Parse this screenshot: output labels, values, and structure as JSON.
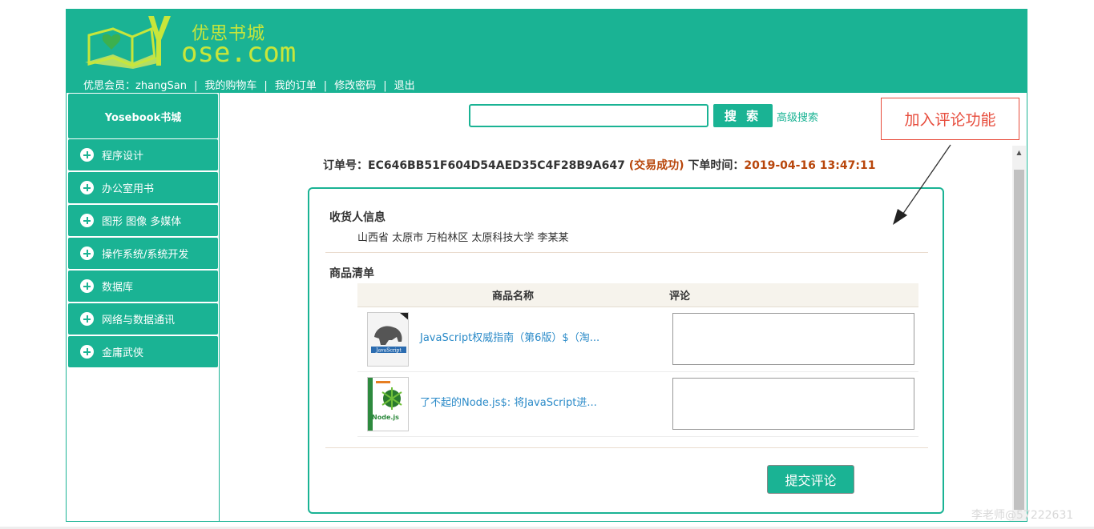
{
  "header": {
    "logo_cn": "优思书城",
    "logo_en": "ose.com",
    "logo_y": "Y",
    "user_label": "优思会员：zhangSan",
    "nav": [
      "我的购物车",
      "我的订单",
      "修改密码",
      "退出"
    ]
  },
  "sidebar": {
    "title": "Yosebook书城",
    "items": [
      "程序设计",
      "办公室用书",
      "图形 图像 多媒体",
      "操作系统/系统开发",
      "数据库",
      "网络与数据通讯",
      "金庸武侠"
    ]
  },
  "search": {
    "button": "搜 索",
    "advanced": "高级搜索",
    "value": ""
  },
  "order": {
    "label": "订单号：",
    "number": "EC646BB51F604D54AED35C4F28B9A647",
    "status": "(交易成功)",
    "time_label": "下单时间：",
    "time": "2019-04-16 13:47:11"
  },
  "receiver": {
    "title": "收货人信息",
    "address": "山西省 太原市 万柏林区 太原科技大学 李某某"
  },
  "items_section": {
    "title": "商品清单",
    "col_name": "商品名称",
    "col_comment": "评论",
    "rows": [
      {
        "name": "JavaScript权威指南（第6版）$（淘...",
        "comment": ""
      },
      {
        "name": "了不起的Node.js$: 将JavaScript进...",
        "comment": ""
      }
    ],
    "submit": "提交评论"
  },
  "annotation": {
    "text": "加入评论功能",
    "color": "#e74c3c"
  },
  "colors": {
    "primary": "#1ab394",
    "status": "#b8460b",
    "link": "#2a8ac8"
  },
  "watermark": "李老师@57222631"
}
